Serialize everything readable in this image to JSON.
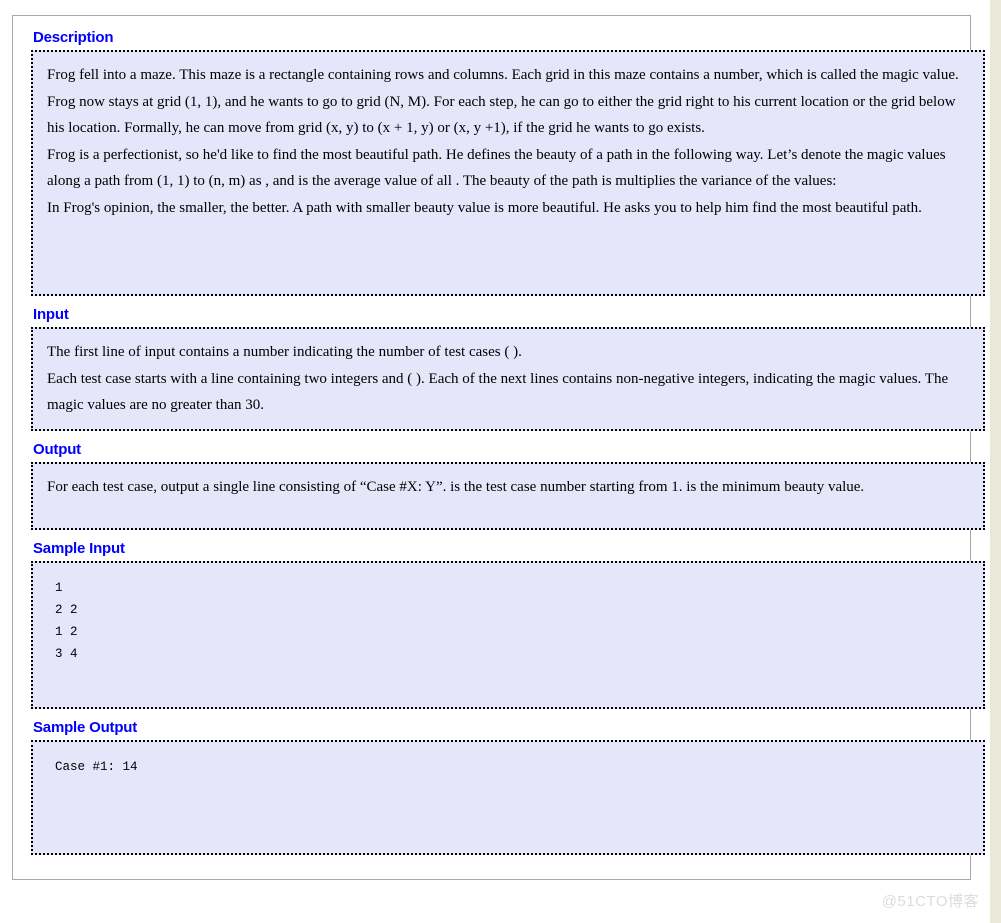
{
  "sections": [
    {
      "id": "description",
      "header": "Description",
      "paragraphs": [
        "Frog fell into a maze. This maze is a rectangle containing  rows and  columns. Each grid in this maze contains a number, which is called the magic value. Frog now stays at grid (1, 1), and he wants to go to grid (N, M). For each step, he can go to either the grid right to his current location or the grid below his location. Formally, he can move from grid (x, y) to (x + 1, y) or (x, y +1), if the grid he wants to go exists.",
        "Frog is a perfectionist, so he'd like to find the most beautiful path. He defines the beauty of a path in the following way. Let’s denote the magic values along a path from (1, 1) to (n, m) as , and  is the average value of all . The beauty of the path is  multiplies the variance of the values:",
        "In Frog's opinion, the smaller, the better. A path with smaller beauty value is more beautiful. He asks you to help him find the most beautiful path."
      ]
    },
    {
      "id": "input",
      "header": "Input",
      "paragraphs": [
        "The first line of input contains a number  indicating the number of test cases ( ).",
        "Each test case starts with a line containing two integers  and  ( ). Each of the next  lines contains  non-negative integers, indicating the magic values. The magic values are no greater than 30."
      ]
    },
    {
      "id": "output",
      "header": "Output",
      "paragraphs": [
        "For each test case, output a single line consisting of “Case #X: Y”.  is the test case number starting from 1.  is the minimum beauty value."
      ]
    }
  ],
  "sample_input": {
    "header": "Sample Input",
    "code": "1\n2 2\n1 2\n3 4"
  },
  "sample_output": {
    "header": "Sample Output",
    "code": "Case #1: 14"
  },
  "watermark": {
    "text": "@51CTO博客"
  },
  "colors": {
    "header_blue": "#0000FF",
    "panel_background": "#E6E6FA",
    "panel_border": "#000000",
    "frame_border": "#A8A8A8",
    "watermark": "#DCDCDC"
  }
}
